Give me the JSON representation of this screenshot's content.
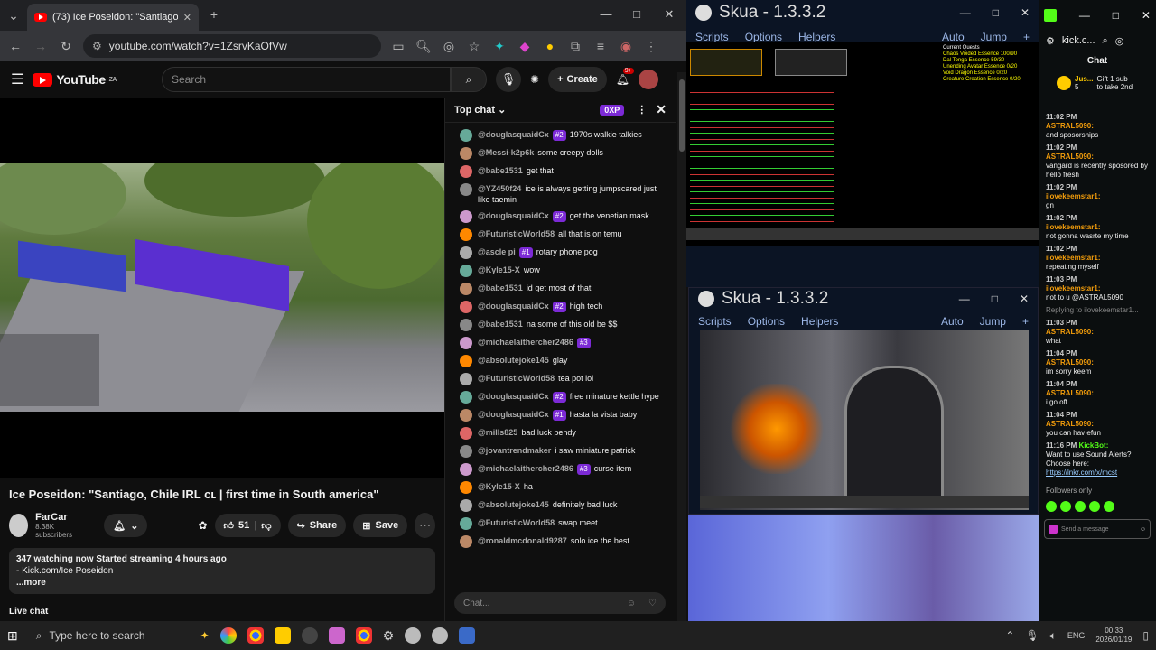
{
  "browser": {
    "tab_title": "(73) Ice Poseidon: \"Santiago",
    "url": "youtube.com/watch?v=1ZsrvKaOfVw"
  },
  "youtube": {
    "region": "ZA",
    "search_placeholder": "Search",
    "create_label": "Create",
    "notif_count": "9+",
    "video_title": "Ice Poseidon: \"Santiago, Chile IRL cʟ | first time in South america\"",
    "channel_name": "FarCar",
    "subscribers": "8.38K subscribers",
    "likes": "51",
    "share_label": "Share",
    "save_label": "Save",
    "desc_line1": "347 watching now  Started streaming 4 hours ago",
    "desc_line2": "- Kick.com/Ice Poseidon",
    "more_label": "...more",
    "live_chat_label": "Live chat",
    "chat_header": "Top chat",
    "xp_badge": "0XP",
    "chat_placeholder": "Chat...",
    "chat_messages": [
      {
        "user": "@douglasquaidCx",
        "badge": "#2",
        "text": "1970s walkie talkies"
      },
      {
        "user": "@Messi-k2p6k",
        "badge": "",
        "text": "some creepy dolls"
      },
      {
        "user": "@babe1531",
        "badge": "",
        "text": "get that"
      },
      {
        "user": "@YZ450f24",
        "badge": "",
        "text": "ice is always getting jumpscared just like taemin"
      },
      {
        "user": "@douglasquaidCx",
        "badge": "#2",
        "text": "get the venetian mask"
      },
      {
        "user": "@FuturisticWorld58",
        "badge": "",
        "text": "all that is on temu"
      },
      {
        "user": "@ascle pi",
        "badge": "#1",
        "text": "rotary phone pog"
      },
      {
        "user": "@Kyle15-X",
        "badge": "",
        "text": "wow"
      },
      {
        "user": "@babe1531",
        "badge": "",
        "text": "id get most of that"
      },
      {
        "user": "@douglasquaidCx",
        "badge": "#2",
        "text": "high tech"
      },
      {
        "user": "@babe1531",
        "badge": "",
        "text": "na some of this old be $$"
      },
      {
        "user": "@michaelaithercher2486",
        "badge": "#3",
        "text": ""
      },
      {
        "user": "@absolutejoke145",
        "badge": "",
        "text": "glay"
      },
      {
        "user": "@FuturisticWorld58",
        "badge": "",
        "text": "tea pot lol"
      },
      {
        "user": "@douglasquaidCx",
        "badge": "#2",
        "text": "free minature kettle hype"
      },
      {
        "user": "@douglasquaidCx",
        "badge": "#1",
        "text": "hasta la vista baby"
      },
      {
        "user": "@mills825",
        "badge": "",
        "text": "bad luck pendy"
      },
      {
        "user": "@jovantrendmaker",
        "badge": "",
        "text": "i saw miniature patrick"
      },
      {
        "user": "@michaelaithercher2486",
        "badge": "#3",
        "text": "curse item"
      },
      {
        "user": "@Kyle15-X",
        "badge": "",
        "text": "ha"
      },
      {
        "user": "@absolutejoke145",
        "badge": "",
        "text": "definitely bad luck"
      },
      {
        "user": "@FuturisticWorld58",
        "badge": "",
        "text": "swap meet"
      },
      {
        "user": "@ronaldmcdonald9287",
        "badge": "",
        "text": "solo ice the best"
      }
    ]
  },
  "skua1": {
    "title": "Skua - 1.3.3.2",
    "menu": [
      "Scripts",
      "Options",
      "Helpers"
    ],
    "auto": "Auto",
    "jump": "Jump",
    "quest_title": "Current Quests",
    "quest_lines": [
      "Chaos Voided Essence 100/90",
      "Dal Tonga Essence 59/30",
      "Unending Avatar Essence 0/20",
      "Void Dragon Essence 0/20",
      "Creature Creation Essence 0/20"
    ]
  },
  "skua2": {
    "title": "Skua - 1.3.3.2",
    "menu": [
      "Scripts",
      "Options",
      "Helpers"
    ],
    "auto": "Auto",
    "jump": "Jump"
  },
  "kick": {
    "url": "kick.c...",
    "chat_label": "Chat",
    "gift_user": "Jus...",
    "gift_count": "5",
    "gift_text": "Gift 1 sub to take 2nd",
    "messages": [
      {
        "time": "11:02 PM",
        "user": "ASTRAL5090:",
        "text": "and sposorships"
      },
      {
        "time": "11:02 PM",
        "user": "ASTRAL5090:",
        "text": "vangard is recently sposored by hello fresh"
      },
      {
        "time": "11:02 PM",
        "user": "ilovekeemstar1:",
        "text": "gn"
      },
      {
        "time": "11:02 PM",
        "user": "ilovekeemstar1:",
        "text": "not gonna wasrte my time"
      },
      {
        "time": "11:02 PM",
        "user": "ilovekeemstar1:",
        "text": "repeating myself"
      },
      {
        "time": "11:03 PM",
        "user": "ilovekeemstar1:",
        "text": "not to u @ASTRAL5090"
      },
      {
        "time": "11:03 PM",
        "user": "ASTRAL5090:",
        "text": "what"
      },
      {
        "time": "11:04 PM",
        "user": "ASTRAL5090:",
        "text": "im sorry keem"
      },
      {
        "time": "11:04 PM",
        "user": "ASTRAL5090:",
        "text": "i go off"
      },
      {
        "time": "11:04 PM",
        "user": "ASTRAL5090:",
        "text": "you can hav efun"
      }
    ],
    "reply_note": "Replying to ilovekeemstar1...",
    "bot_time": "11:16 PM",
    "bot_user": "KickBot:",
    "bot_text": "Want to use Sound Alerts? Choose here:",
    "bot_link": "https://lnkr.com/x/mcst",
    "followers_only": "Followers only",
    "send_placeholder": "Send a message"
  },
  "taskbar": {
    "search_placeholder": "Type here to search",
    "lang": "ENG",
    "time": "00:33",
    "date": "2026/01/19"
  }
}
